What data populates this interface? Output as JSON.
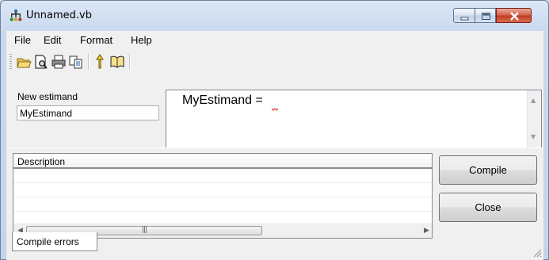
{
  "window": {
    "title": "Unnamed.vb"
  },
  "menu": {
    "items": [
      "File",
      "Edit",
      "Format",
      "Help"
    ]
  },
  "toolbar": {
    "icons": [
      "open-folder-icon",
      "print-preview-icon",
      "print-icon",
      "copy-icon",
      "pointer-icon",
      "help-book-icon"
    ]
  },
  "estimand": {
    "label": "New estimand",
    "value": "MyEstimand"
  },
  "editor": {
    "text": "MyEstimand ="
  },
  "grid": {
    "column_header": "Description"
  },
  "buttons": {
    "compile": "Compile",
    "close": "Close"
  },
  "tabs": {
    "compile_errors": "Compile errors"
  }
}
